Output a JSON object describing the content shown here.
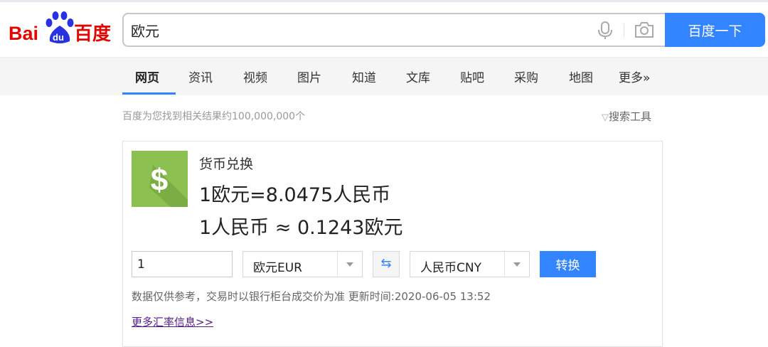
{
  "logo": {
    "text_latin": "Bai",
    "text_du": "du",
    "text_cn": "百度"
  },
  "search": {
    "query": "欧元",
    "button_label": "百度一下"
  },
  "nav": {
    "tabs": [
      {
        "label": "网页",
        "active": true
      },
      {
        "label": "资讯"
      },
      {
        "label": "视频"
      },
      {
        "label": "图片"
      },
      {
        "label": "知道"
      },
      {
        "label": "文库"
      },
      {
        "label": "贴吧"
      },
      {
        "label": "采购"
      },
      {
        "label": "地图"
      },
      {
        "label": "更多»"
      }
    ]
  },
  "results": {
    "count_text": "百度为您找到相关结果约100,000,000个",
    "tools_label": "搜索工具"
  },
  "converter": {
    "title": "货币兑换",
    "rate_line1": "1欧元=8.0475人民币",
    "rate_line2": "1人民币 ≈ 0.1243欧元",
    "amount": "1",
    "from_currency": "欧元EUR",
    "to_currency": "人民币CNY",
    "convert_label": "转换",
    "note": "数据仅供参考，交易时以银行柜台成交价为准 更新时间:2020-06-05 13:52",
    "more_link": "更多汇率信息>>"
  },
  "colors": {
    "accent": "#3385ff",
    "logo_red": "#e10601",
    "logo_blue": "#2932e1",
    "icon_green": "#8cc152",
    "visited_link": "#551a8b"
  }
}
